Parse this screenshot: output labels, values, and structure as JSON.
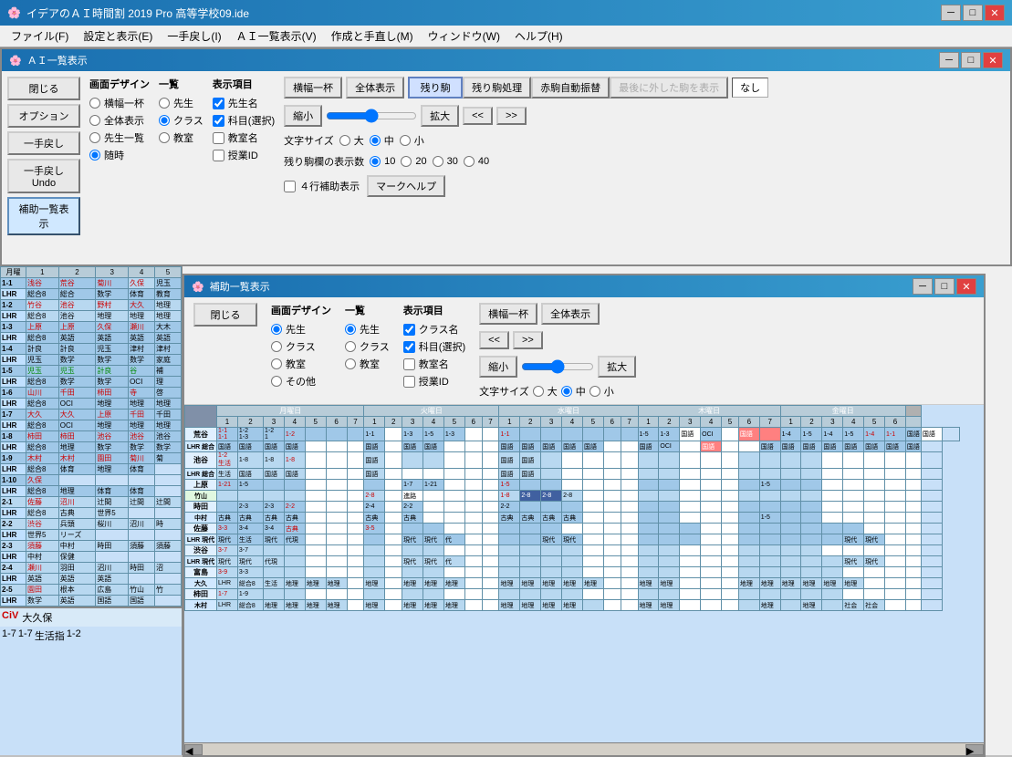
{
  "app": {
    "title": "イデアのＡＩ時間割 2019 Pro 高等学校09.ide",
    "icon": "🌸"
  },
  "menu": {
    "items": [
      "ファイル(F)",
      "設定と表示(E)",
      "一手戻し(I)",
      "ＡＩ一覧表示(V)",
      "作成と手直し(M)",
      "ウィンドウ(W)",
      "ヘルプ(H)"
    ]
  },
  "ai_panel": {
    "title": "ＡＩ一覧表示",
    "icon": "🌸",
    "buttons": {
      "close": "閉じる",
      "option": "オプション",
      "undo": "一手戻し",
      "undo2": "一手戻しUndo",
      "hojo": "補助一覧表示"
    },
    "display": {
      "label": "画面デザイン",
      "options": [
        "横幅一杯",
        "全体表示",
        "先生一覧"
      ]
    },
    "ichiran": {
      "label": "一覧",
      "options": [
        "先生",
        "クラス",
        "教室"
      ]
    },
    "hyoji": {
      "label": "表示項目",
      "items": [
        "先生名",
        "科目(選択)",
        "教室名",
        "授業ID"
      ]
    },
    "toolbar": {
      "yokohaba": "横幅一杯",
      "zentai": "全体表示",
      "nokori": "残り駒",
      "nokori_syori": "残り駒処理",
      "akauma": "赤駒自動振替",
      "saigo": "最後に外した駒を表示",
      "shrink": "縮小",
      "expand": "拡大",
      "first": "<<",
      "last": ">>"
    },
    "font_size": {
      "label": "文字サイズ",
      "options": [
        "大",
        "中",
        "小"
      ]
    },
    "display_count": {
      "label": "残り駒欄の表示数",
      "options": [
        "10",
        "20",
        "30",
        "40"
      ]
    },
    "extra": [
      "４行補助表示",
      "マークヘルプ"
    ],
    "naoshi_text": "なし"
  },
  "overlay": {
    "title": "補助一覧表示",
    "icon": "🌸",
    "close_btn": "×",
    "min_btn": "─",
    "max_btn": "□",
    "display": {
      "label": "画面デザイン",
      "options": [
        "先生",
        "クラス",
        "教室",
        "その他"
      ]
    },
    "ichiran": {
      "label": "一覧",
      "options": [
        "先生",
        "クラス",
        "教室"
      ]
    },
    "hyoji": {
      "label": "表示項目",
      "items": [
        "クラス名",
        "科目(選択)",
        "教室名",
        "授業ID"
      ]
    },
    "toolbar2": {
      "yokohaba": "横幅一杯",
      "zentai": "全体表示",
      "prev": "<<",
      "next": ">>",
      "shrink": "縮小",
      "expand": "拡大"
    },
    "font_size": {
      "label": "文字サイズ",
      "options": [
        "大",
        "中",
        "小"
      ]
    },
    "close_label": "閉じる"
  },
  "timetable": {
    "days": [
      "月曜日",
      "火曜日",
      "水曜日",
      "木曜日",
      "金曜日"
    ],
    "periods": [
      "1",
      "2",
      "3",
      "4",
      "5"
    ],
    "rows": [
      {
        "id": "1-1",
        "label": "1-1"
      },
      {
        "id": "1-2",
        "label": "1-2"
      },
      {
        "id": "1-3",
        "label": "1-3"
      },
      {
        "id": "1-4",
        "label": "1-4"
      },
      {
        "id": "1-5",
        "label": "1-5"
      },
      {
        "id": "1-6",
        "label": "1-6"
      },
      {
        "id": "1-7",
        "label": "1-7"
      },
      {
        "id": "1-8",
        "label": "1-8"
      },
      {
        "id": "1-9",
        "label": "1-9"
      },
      {
        "id": "1-10",
        "label": "1-10"
      },
      {
        "id": "2-1",
        "label": "2-1"
      },
      {
        "id": "2-2",
        "label": "2-2"
      },
      {
        "id": "2-3",
        "label": "2-3"
      },
      {
        "id": "2-4",
        "label": "2-4"
      },
      {
        "id": "2-5",
        "label": "2-5"
      }
    ]
  },
  "colors": {
    "title_bg": "#1a6fb0",
    "accent": "#3a9fd0",
    "cell_blue": "#a0c8e8",
    "cell_red": "#ff6060",
    "cell_green": "#80c880"
  }
}
